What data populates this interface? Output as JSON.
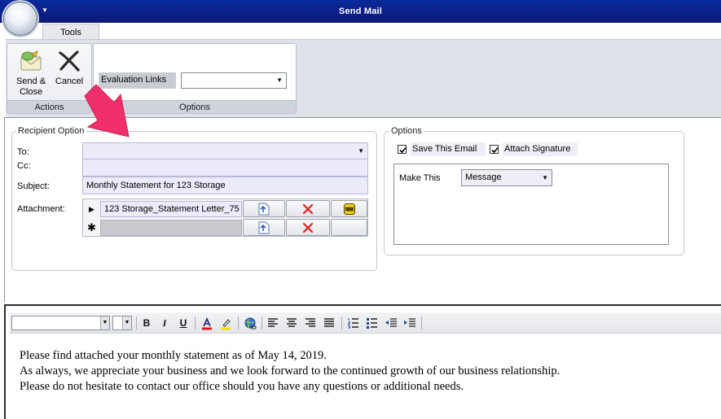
{
  "window": {
    "title": "Send Mail"
  },
  "ribbon": {
    "tab": "Tools",
    "actions": {
      "group_label": "Actions",
      "send_close_line1": "Send &",
      "send_close_line2": "Close",
      "cancel_label": "Cancel"
    },
    "options": {
      "group_label": "Options",
      "evaluation_links_label": "Evaluation Links",
      "evaluation_links_value": ""
    }
  },
  "recipient": {
    "legend": "Recipient Option",
    "to_label": "To:",
    "to_value": "",
    "cc_label": "Cc:",
    "cc_value": "",
    "subject_label": "Subject:",
    "subject_value": "Monthly Statement for 123 Storage",
    "attachment_label": "Attachment:",
    "attachments": [
      {
        "file": "123 Storage_Statement Letter_75"
      }
    ]
  },
  "options": {
    "legend": "Options",
    "save_email_label": "Save This Email",
    "save_email_checked": true,
    "attach_signature_label": "Attach Signature",
    "attach_signature_checked": true,
    "make_this_label": "Make This",
    "make_this_value": "Message"
  },
  "editor": {
    "font_value": "",
    "size_value": "",
    "body_lines": [
      "Please find attached your monthly statement as of May 14, 2019.",
      "As always, we appreciate your business and we look forward to the continued growth of our business relationship.",
      "Please do not hesitate to contact our office should you have any questions or additional needs."
    ]
  },
  "colors": {
    "titlebar": "#0b1f86",
    "field_fill": "#ebebfa",
    "pointer_arrow": "#f0306a"
  }
}
